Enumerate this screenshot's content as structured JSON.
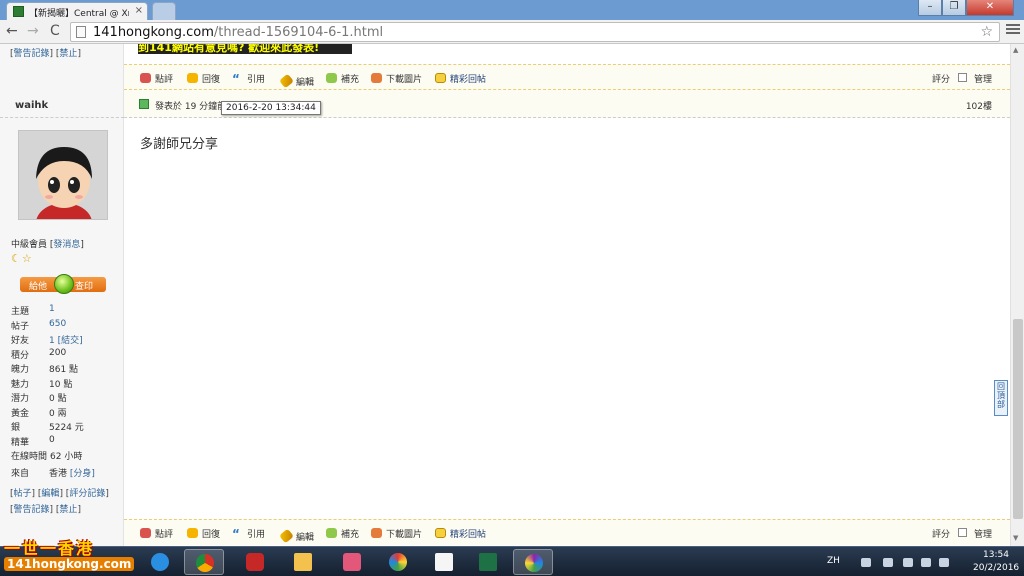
{
  "browser": {
    "tab_title": "【新揭曬】Central @ Xm",
    "tab_close": "×",
    "url_host": "141hongkong.com",
    "url_path": "/thread-1569104-6-1.html",
    "window_buttons": {
      "minimize": "–",
      "maximize": "❐",
      "close": "✕"
    }
  },
  "prev_post": {
    "banner_text": "到141網站有意見嗎? 歡迎來此發表!",
    "links": [
      "警告記錄",
      "禁止"
    ]
  },
  "actions": {
    "rate": "點評",
    "reply": "回復",
    "quote": "引用",
    "edit": "編輯",
    "supplement": "補充",
    "download_images": "下載圖片",
    "best_reply": "精彩回帖",
    "score": "評分",
    "manage": "管理"
  },
  "author": {
    "name": "waihk",
    "rank": "中級會員",
    "send_message": "發消息",
    "rank_icons": "☾☆",
    "vote_give": "給他",
    "vote_check": "查印",
    "stats": [
      {
        "label": "主題",
        "value": "1"
      },
      {
        "label": "帖子",
        "value": "650"
      },
      {
        "label": "好友",
        "value": "1",
        "extra": "[結交]"
      },
      {
        "label": "積分",
        "value": "200"
      },
      {
        "label": "魄力",
        "value": "861 點"
      },
      {
        "label": "魅力",
        "value": "10 點"
      },
      {
        "label": "潛力",
        "value": "0 點"
      },
      {
        "label": "黃金",
        "value": "0 兩"
      },
      {
        "label": "銀",
        "value": "5224 元"
      },
      {
        "label": "精華",
        "value": "0"
      },
      {
        "label": "在線時間",
        "value": "62 小時"
      }
    ],
    "from_label": "來自",
    "from_value": "香港",
    "from_extra": "[分身]",
    "links_row1": [
      "帖子",
      "編輯",
      "評分記錄"
    ],
    "links_row2": [
      "警告記錄",
      "禁止"
    ]
  },
  "post": {
    "posted_text": "發表於 19 分鐘前",
    "tooltip": "2016-2-20 13:34:44",
    "floor": "102樓",
    "body": "多謝師兄分享"
  },
  "back_to_top": "回頂部",
  "taskbar": {
    "logo_line1": "一世一香港",
    "logo_line2": "141hongkong.com",
    "lang": "ZH",
    "time": "13:54",
    "date": "20/2/2016"
  },
  "colors": {
    "action_bar_bg": "#fdfcf2",
    "dashed_border": "#e8cf74",
    "link": "#336699",
    "orange_button": "#e06d10"
  }
}
